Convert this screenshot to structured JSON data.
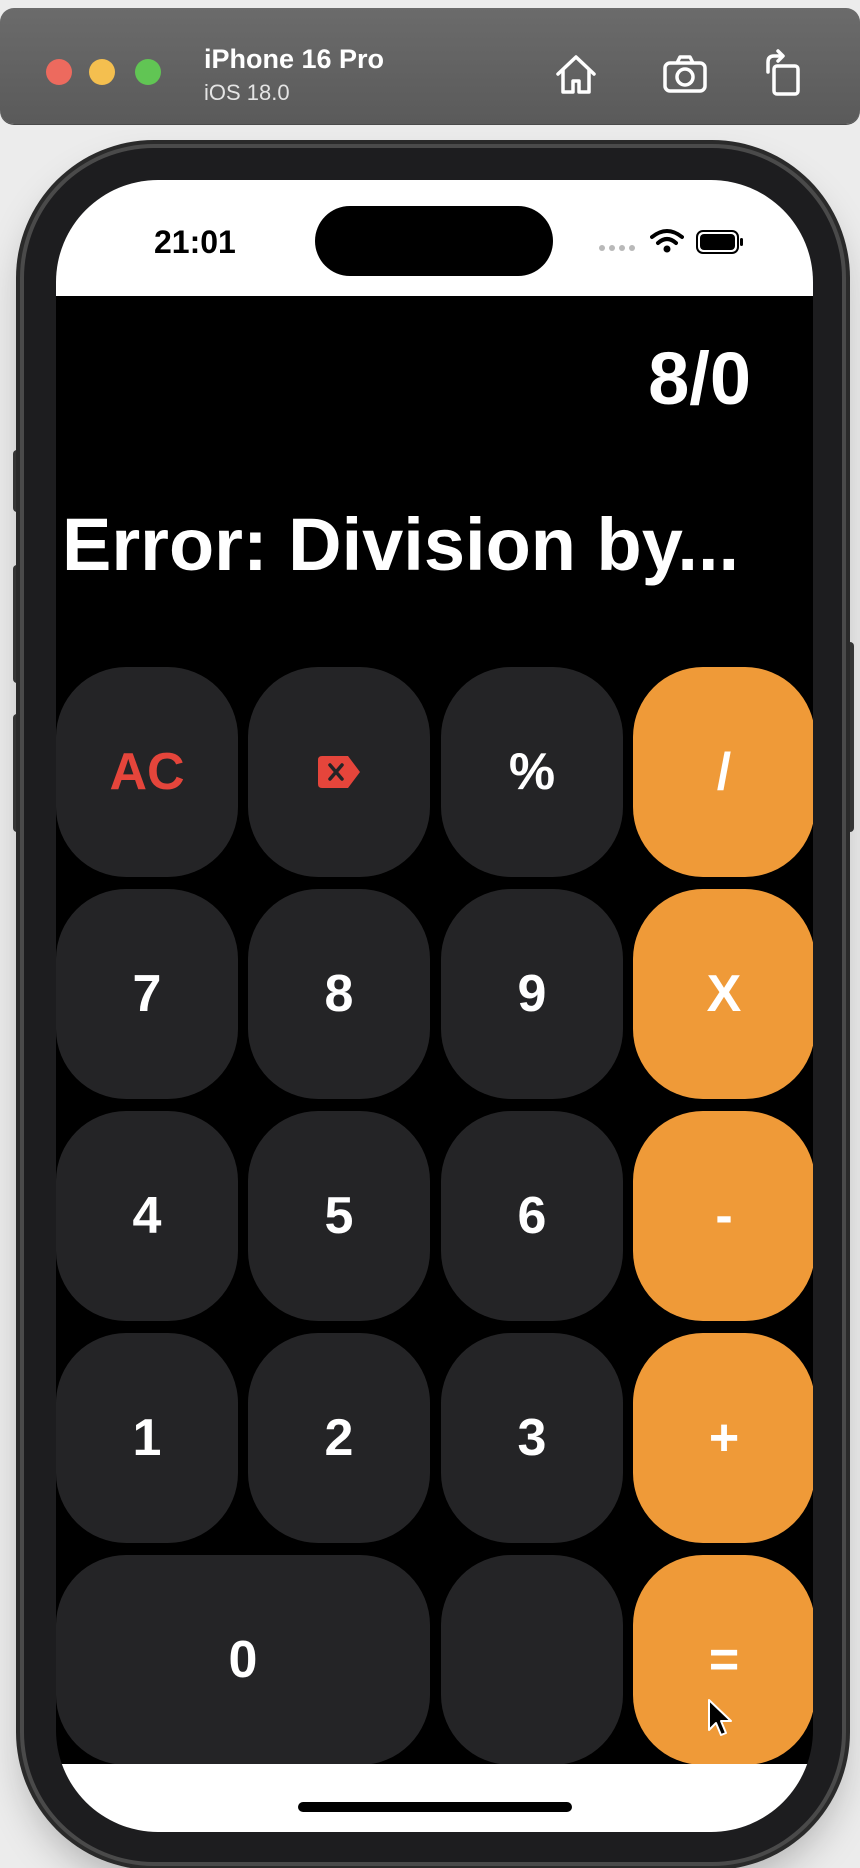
{
  "toolbar": {
    "device_name": "iPhone 16 Pro",
    "os_version": "iOS 18.0",
    "icons": [
      "home-icon",
      "screenshot-icon",
      "rotate-icon"
    ]
  },
  "status_bar": {
    "time": "21:01",
    "icons": [
      "wifi-icon",
      "battery-icon"
    ]
  },
  "display": {
    "expression": "8/0",
    "result": "Error: Division by..."
  },
  "keypad": {
    "rows": [
      [
        "AC",
        "delete-icon",
        "%",
        "/"
      ],
      [
        "7",
        "8",
        "9",
        "X"
      ],
      [
        "4",
        "5",
        "6",
        "-"
      ],
      [
        "1",
        "2",
        "3",
        "+"
      ],
      [
        "0",
        "",
        "="
      ]
    ],
    "keys": {
      "ac": "AC",
      "percent": "%",
      "divide": "/",
      "seven": "7",
      "eight": "8",
      "nine": "9",
      "multiply": "X",
      "four": "4",
      "five": "5",
      "six": "6",
      "minus": "-",
      "one": "1",
      "two": "2",
      "three": "3",
      "plus": "+",
      "zero": "0",
      "decimal": "",
      "equals": "="
    }
  },
  "colors": {
    "operator": "#ef9a38",
    "key": "#242426",
    "clear": "#e5453b",
    "background": "#000000"
  }
}
